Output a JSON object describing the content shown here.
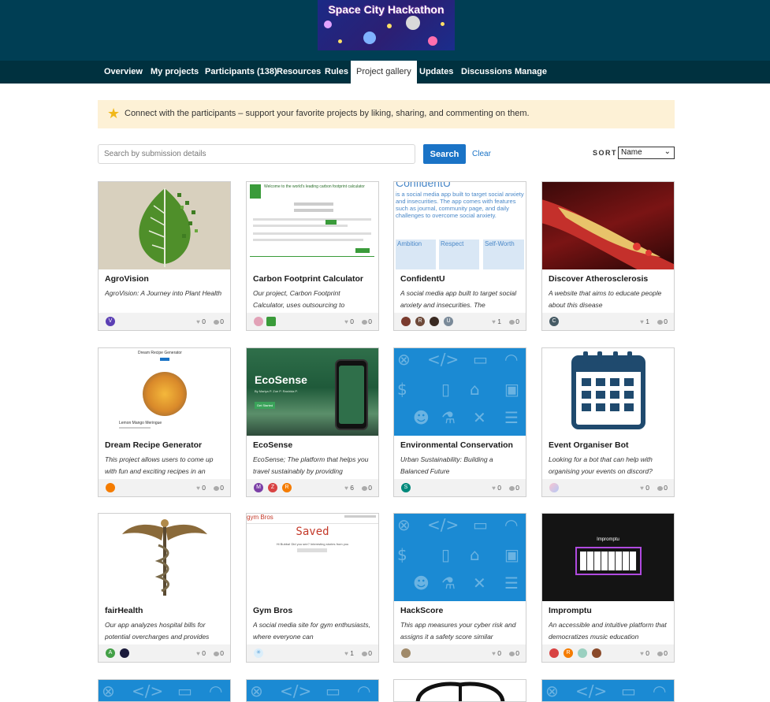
{
  "header": {
    "title": "Space City Hackathon"
  },
  "nav": {
    "items": [
      "Overview",
      "My projects",
      "Participants (138)",
      "Resources",
      "Rules",
      "Project gallery",
      "Updates",
      "Discussions",
      "Manage"
    ],
    "active": "Project gallery"
  },
  "notice": {
    "text": "Connect with the participants – support your favorite projects by liking, sharing, and commenting on them.",
    "icon": "star-icon"
  },
  "search": {
    "placeholder": "Search by submission details",
    "button_label": "Search",
    "clear_label": "Clear"
  },
  "sort": {
    "label": "SORT",
    "selected": "Name"
  },
  "projects": [
    {
      "title": "AgroVision",
      "desc": "AgroVision: A Journey into Plant Health",
      "likes": "0",
      "comments": "0",
      "avatars": [
        "V"
      ]
    },
    {
      "title": "Carbon Footprint Calculator",
      "desc": "Our project, Carbon Footprint Calculator, uses outsourcing to",
      "likes": "0",
      "comments": "0",
      "avatars": [
        "",
        ""
      ]
    },
    {
      "title": "ConfidentU",
      "desc": "A social media app built to target social anxiety and insecurities. The",
      "likes": "1",
      "comments": "0",
      "avatars": [
        "",
        "R",
        "",
        "U"
      ]
    },
    {
      "title": "Discover Atherosclerosis",
      "desc": "A website that aims to educate people about this disease",
      "likes": "1",
      "comments": "0",
      "avatars": [
        "C"
      ]
    },
    {
      "title": "Dream Recipe Generator",
      "desc": "This project allows users to come up with fun and exciting recipes in an",
      "likes": "0",
      "comments": "0",
      "avatars": [
        ""
      ]
    },
    {
      "title": "EcoSense",
      "desc": "EcoSense; The platform that helps you travel sustainably by providing",
      "likes": "6",
      "comments": "0",
      "avatars": [
        "M",
        "Z",
        "R"
      ]
    },
    {
      "title": "Environmental Conservation",
      "desc": "Urban Sustainability: Building a Balanced Future",
      "likes": "0",
      "comments": "0",
      "avatars": [
        "S"
      ]
    },
    {
      "title": "Event Organiser Bot",
      "desc": "Looking for a bot that can help with organising your events on discord?",
      "likes": "0",
      "comments": "0",
      "avatars": [
        ""
      ]
    },
    {
      "title": "fairHealth",
      "desc": "Our app analyzes hospital bills for potential overcharges and provides",
      "likes": "0",
      "comments": "0",
      "avatars": [
        "A",
        ""
      ]
    },
    {
      "title": "Gym Bros",
      "desc": "A social media site for gym enthusiasts, where everyone can",
      "likes": "1",
      "comments": "0",
      "avatars": [
        ""
      ]
    },
    {
      "title": "HackScore",
      "desc": "This app measures your cyber risk and assigns it a safety score similar",
      "likes": "0",
      "comments": "0",
      "avatars": [
        ""
      ]
    },
    {
      "title": "Impromptu",
      "desc": "An accessible and intuitive platform that democratizes music education",
      "likes": "0",
      "comments": "0",
      "avatars": [
        "",
        "R",
        "",
        ""
      ]
    }
  ],
  "thumb_text": {
    "confident_heading": "ConfidentU",
    "confident_body": "is a social media app built to target social anxiety and insecurities. The app comes with features such as journal, community page, and daily challenges to overcome social anxiety.",
    "confident_cols": [
      "Ambition",
      "Respect",
      "Self-Worth"
    ],
    "ecosense_brand": "EcoSense",
    "ecosense_tagline": "By Mariya P. Zoe P. Rashida P.",
    "ecosense_button": "Get Started",
    "gym_brand": "gym Bros",
    "gym_saved": "Saved",
    "gym_note": "Hi Bubba! Did you see? Interesting stories from you",
    "impromptu_label": "Impromptu",
    "recipe_title": "Dream Recipe Generator",
    "recipe_caption": "Lemon Mango Meringue",
    "carbon_title": "Welcome to the world's leading carbon footprint calculator"
  }
}
